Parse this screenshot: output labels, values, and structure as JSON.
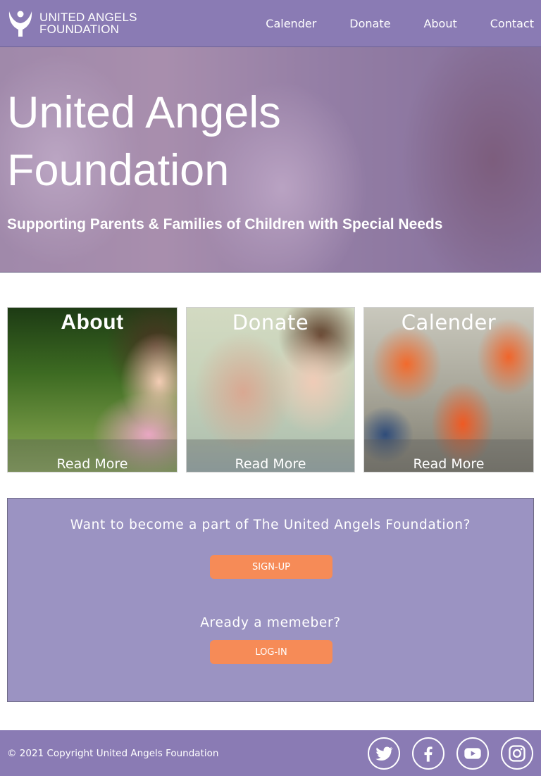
{
  "header": {
    "logo_line1": "UNITED ANGELS",
    "logo_line2": "FOUNDATION",
    "nav": [
      "Calender",
      "Donate",
      "About",
      "Contact"
    ]
  },
  "hero": {
    "title_line1": "United Angels",
    "title_line2": "Foundation",
    "subtitle": "Supporting Parents & Families of Children with Special Needs"
  },
  "cards": [
    {
      "title": "About",
      "more": "Read More"
    },
    {
      "title": "Donate",
      "more": "Read More"
    },
    {
      "title": "Calender",
      "more": "Read More"
    }
  ],
  "join": {
    "question": "Want to become a part of The United Angels Foundation?",
    "signup_label": "SIGN-UP",
    "member_question": "Aready a memeber?",
    "login_label": "LOG-IN"
  },
  "footer": {
    "copyright": "© 2021 Copyright United Angels Foundation",
    "social": [
      "twitter-icon",
      "facebook-icon",
      "youtube-icon",
      "instagram-icon"
    ]
  },
  "colors": {
    "nav": "#8a7bb4",
    "join_box": "#9b93c2",
    "button": "#f68b57"
  }
}
